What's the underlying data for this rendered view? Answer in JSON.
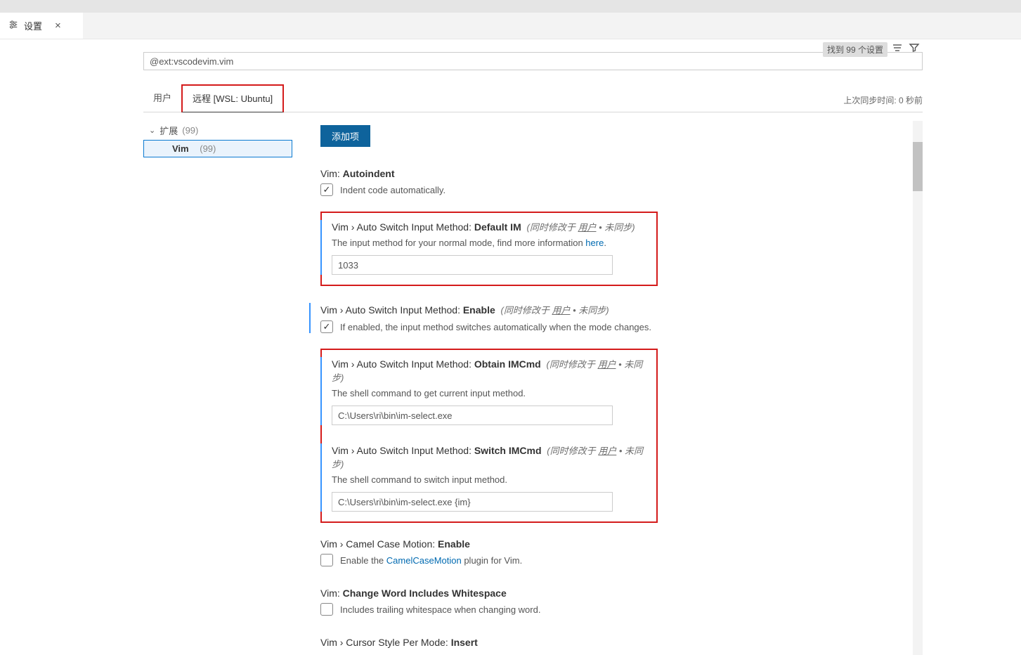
{
  "tab": {
    "label": "设置"
  },
  "search": {
    "value": "@ext:vscodevim.vim",
    "found_badge": "找到 99 个设置"
  },
  "scope_tabs": {
    "user": "用户",
    "remote": "远程 [WSL: Ubuntu]",
    "sync_info": "上次同步时间: 0 秒前"
  },
  "tree": {
    "extensions_label": "扩展",
    "extensions_count": "(99)",
    "vim_label": "Vim",
    "vim_count": "(99)"
  },
  "add_button": "添加项",
  "scope_note": {
    "prefix": "(同时修改于 ",
    "user": "用户",
    "suffix": " • 未同步)"
  },
  "settings": {
    "autoindent": {
      "title_prefix": "Vim: ",
      "title_bold": "Autoindent",
      "desc": "Indent code automatically.",
      "checked": true
    },
    "default_im": {
      "title_prefix": "Vim › Auto Switch Input Method: ",
      "title_bold": "Default IM",
      "desc_before": "The input method for your normal mode, find more information ",
      "desc_link": "here",
      "desc_after": ".",
      "value": "1033"
    },
    "enable_im": {
      "title_prefix": "Vim › Auto Switch Input Method: ",
      "title_bold": "Enable",
      "desc": "If enabled, the input method switches automatically when the mode changes.",
      "checked": true
    },
    "obtain_im": {
      "title_prefix": "Vim › Auto Switch Input Method: ",
      "title_bold": "Obtain IMCmd",
      "desc": "The shell command to get current input method.",
      "value": "C:\\Users\\ri\\bin\\im-select.exe"
    },
    "switch_im": {
      "title_prefix": "Vim › Auto Switch Input Method: ",
      "title_bold": "Switch IMCmd",
      "desc": "The shell command to switch input method.",
      "value": "C:\\Users\\ri\\bin\\im-select.exe {im}"
    },
    "camelcase": {
      "title_prefix": "Vim › Camel Case Motion: ",
      "title_bold": "Enable",
      "desc_before": "Enable the ",
      "desc_link": "CamelCaseMotion",
      "desc_after": " plugin for Vim.",
      "checked": false
    },
    "change_word": {
      "title_prefix": "Vim: ",
      "title_bold": "Change Word Includes Whitespace",
      "desc": "Includes trailing whitespace when changing word.",
      "checked": false
    },
    "cursor_style": {
      "title_prefix": "Vim › Cursor Style Per Mode: ",
      "title_bold": "Insert"
    }
  }
}
